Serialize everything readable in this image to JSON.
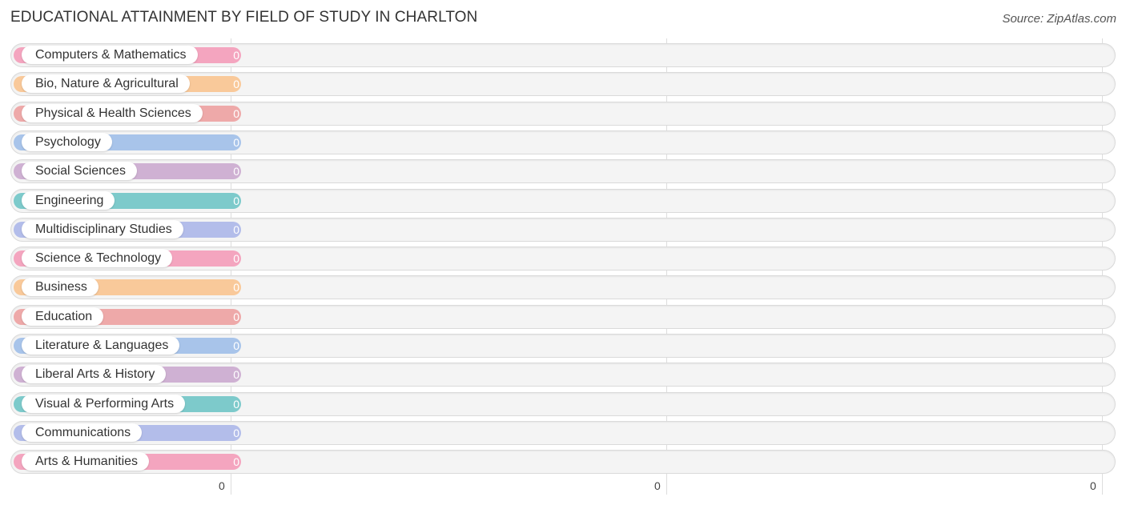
{
  "chart_data": {
    "type": "bar",
    "orientation": "horizontal",
    "title": "EDUCATIONAL ATTAINMENT BY FIELD OF STUDY IN CHARLTON",
    "source": "Source: ZipAtlas.com",
    "xlabel": "",
    "ylabel": "",
    "x_tick_labels": [
      "0",
      "0",
      "0"
    ],
    "grid": true,
    "categories": [
      "Computers & Mathematics",
      "Bio, Nature & Agricultural",
      "Physical & Health Sciences",
      "Psychology",
      "Social Sciences",
      "Engineering",
      "Multidisciplinary Studies",
      "Science & Technology",
      "Business",
      "Education",
      "Literature & Languages",
      "Liberal Arts & History",
      "Visual & Performing Arts",
      "Communications",
      "Arts & Humanities"
    ],
    "values": [
      0,
      0,
      0,
      0,
      0,
      0,
      0,
      0,
      0,
      0,
      0,
      0,
      0,
      0,
      0
    ],
    "value_labels": [
      "0",
      "0",
      "0",
      "0",
      "0",
      "0",
      "0",
      "0",
      "0",
      "0",
      "0",
      "0",
      "0",
      "0",
      "0"
    ],
    "colors": [
      "#f4a5bf",
      "#f9c99a",
      "#eea9a9",
      "#a8c4ea",
      "#cfb1d3",
      "#7dcacb",
      "#b3bdea",
      "#f4a5bf",
      "#f9c99a",
      "#eea9a9",
      "#a8c4ea",
      "#cfb1d3",
      "#7dcacb",
      "#b3bdea",
      "#f4a5bf"
    ]
  }
}
